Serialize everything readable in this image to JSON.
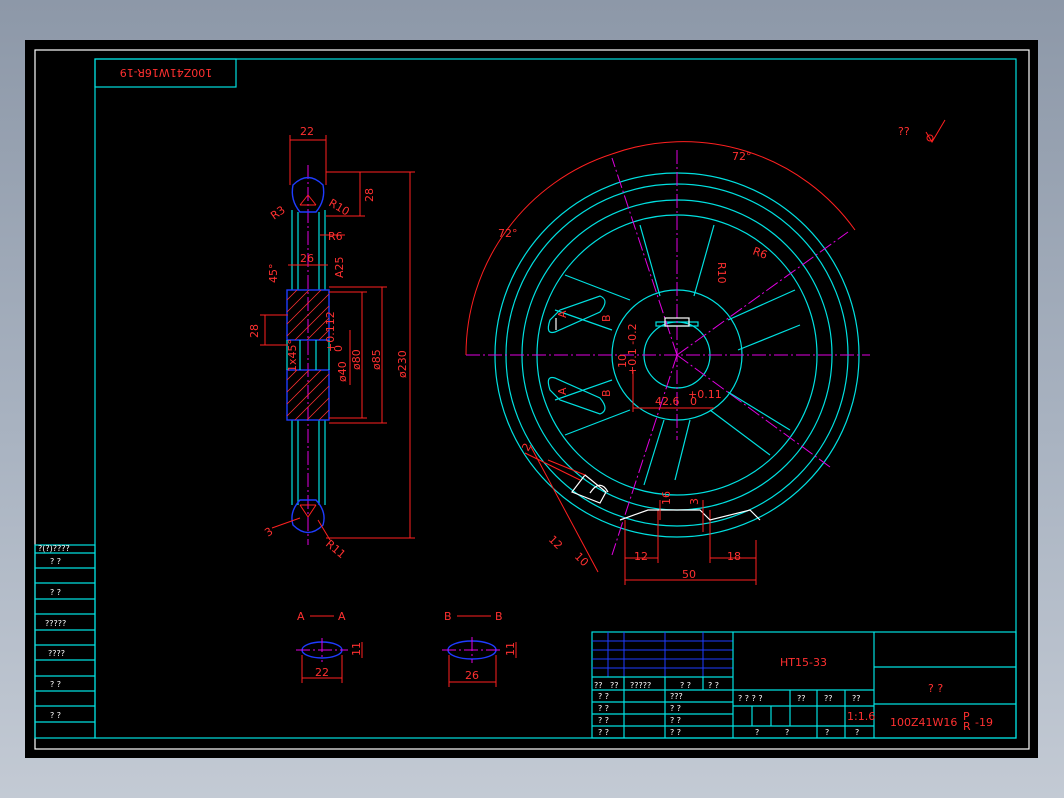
{
  "drawing": {
    "part_code": "100Z41W16",
    "part_code_mirrored": "100Z41W16R-19",
    "part_suffix_top": "P",
    "part_suffix_bottom": "R",
    "part_suffix_end": "-19",
    "material": "HT15-33",
    "scale": "1:1.6",
    "part_name": "?  ?",
    "roughness_note": "??"
  },
  "dimensions": {
    "side_view": {
      "width_top": "22",
      "rim_height": "28",
      "r3": "R3",
      "r10": "R10",
      "r6": "R6",
      "hub_width": "26",
      "hub_height": "28",
      "d40": "ø40",
      "d40_tol_up": "+0.112",
      "d40_tol_lo": "0",
      "d80": "ø80",
      "d85": "ø85",
      "d230": "ø230",
      "chamfer": "1x45°",
      "r11": "R11",
      "r3_bottom": "3",
      "angle_left": "45°",
      "angle_right": "A25"
    },
    "front_view": {
      "angle_1": "72°",
      "angle_2": "72°",
      "r6": "R6",
      "r10": "R10",
      "hub_dim": "42.6",
      "hub_tol_up": "+0.11",
      "hub_tol_lo": "0",
      "d12": "12",
      "d10": "10",
      "d2": "2",
      "d12_bottom": "12",
      "d18": "18",
      "d50": "50",
      "d16": "16",
      "d3": "3",
      "keyway": "10",
      "keyway_tol": "+0.1 -0.2",
      "section_a": "A",
      "section_b": "B"
    },
    "section_aa": {
      "title_left": "A",
      "title_right": "A",
      "width": "22",
      "height": "11"
    },
    "section_bb": {
      "title_left": "B",
      "title_right": "B",
      "width": "26",
      "height": "11"
    }
  },
  "left_column": {
    "rows": [
      "?(?)????",
      "?  ?",
      "?  ?",
      "?????",
      "????",
      "?  ?",
      "?  ?"
    ]
  },
  "title_block": {
    "header_row": [
      "??",
      "??",
      "?????",
      "?  ?",
      "?  ?"
    ],
    "sign_rows": [
      [
        "?  ?",
        "???"
      ],
      [
        "?  ?",
        "?  ?"
      ],
      [
        "?  ?",
        "?  ?"
      ],
      [
        "?  ?",
        "?  ?"
      ]
    ],
    "stage_labels": [
      "?  ?  ?  ?",
      "??",
      "??",
      "??"
    ],
    "sheet_labels": [
      "?",
      "?",
      "?",
      "?"
    ]
  }
}
